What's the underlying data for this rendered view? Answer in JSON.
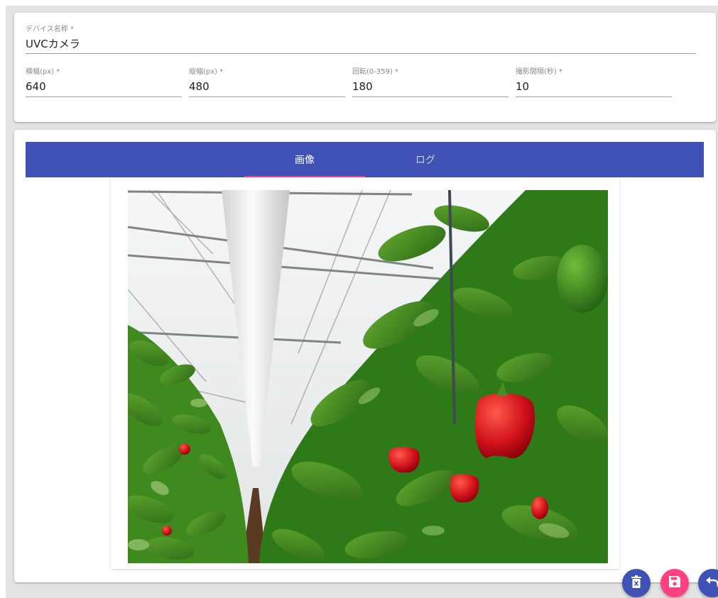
{
  "form": {
    "device_name": {
      "label": "デバイス名称 *",
      "value": "UVCカメラ"
    },
    "width": {
      "label": "横幅(px) *",
      "value": "640"
    },
    "height": {
      "label": "縦幅(px) *",
      "value": "480"
    },
    "rotation": {
      "label": "回転(0-359) *",
      "value": "180"
    },
    "interval": {
      "label": "撮影間隔(秒) *",
      "value": "10"
    }
  },
  "tabs": [
    {
      "label": "画像",
      "active": true
    },
    {
      "label": "ログ",
      "active": false
    }
  ],
  "colors": {
    "primary": "#3f51b5",
    "accent": "#ff4081"
  },
  "fabs": [
    {
      "icon": "delete-icon"
    },
    {
      "icon": "save-icon"
    },
    {
      "icon": "undo-icon"
    }
  ]
}
